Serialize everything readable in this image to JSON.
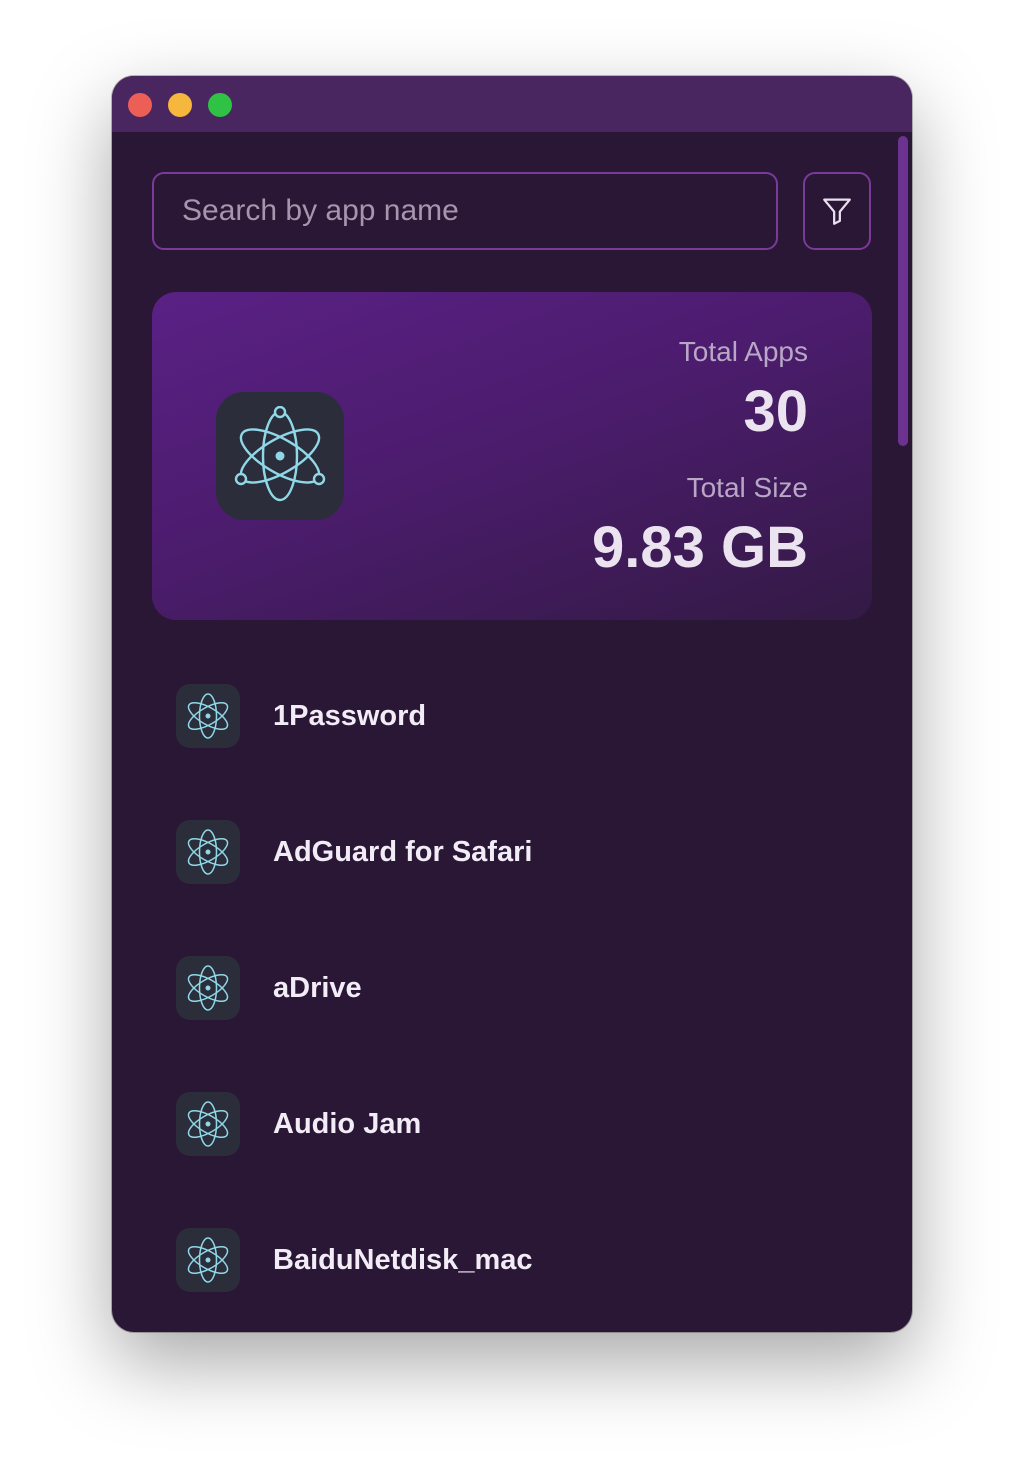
{
  "window": {
    "traffic_lights": {
      "close": "#ec5f57",
      "minimize": "#f5b73c",
      "maximize": "#2fc244"
    }
  },
  "search": {
    "placeholder": "Search by app name",
    "value": ""
  },
  "filter": {
    "icon": "filter-icon"
  },
  "summary": {
    "icon": "electron-atom-icon",
    "total_apps_label": "Total Apps",
    "total_apps_value": "30",
    "total_size_label": "Total Size",
    "total_size_value": "9.83 GB"
  },
  "apps": [
    {
      "name": "1Password",
      "icon": "electron-atom-icon"
    },
    {
      "name": "AdGuard for Safari",
      "icon": "electron-atom-icon"
    },
    {
      "name": "aDrive",
      "icon": "electron-atom-icon"
    },
    {
      "name": "Audio Jam",
      "icon": "electron-atom-icon"
    },
    {
      "name": "BaiduNetdisk_mac",
      "icon": "electron-atom-icon"
    }
  ],
  "colors": {
    "background": "#2a1635",
    "titlebar": "#4a2660",
    "accent": "#7a3a9a",
    "icon_stroke": "#8fd8e8"
  }
}
